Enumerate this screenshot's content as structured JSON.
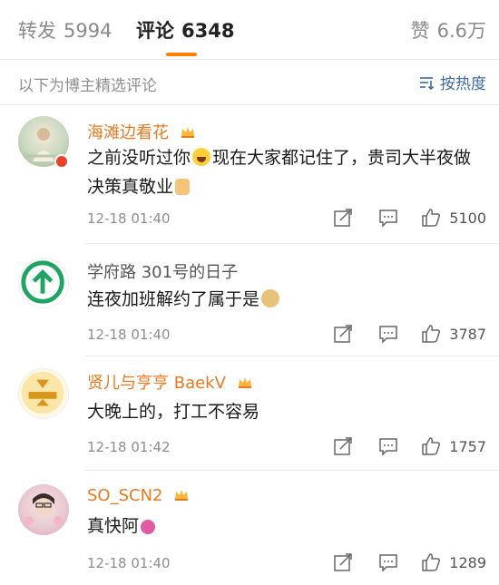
{
  "tabs": {
    "repost_label": "转发",
    "repost_count": "5994",
    "comment_label": "评论",
    "comment_count": "6348",
    "like_label": "赞",
    "like_count": "6.6万"
  },
  "subbar": {
    "label": "以下为博主精选评论",
    "sort_label": "按热度"
  },
  "comments": [
    {
      "name": "海滩边看花",
      "text_a": "之前没听过你",
      "text_b": "现在大家都记住了，贵司大半夜做决策真敬业",
      "time": "12-18 01:40",
      "likes": "5100"
    },
    {
      "name": "学府路 301号的日子",
      "text_a": "连夜加班解约了属于是",
      "time": "12-18 01:40",
      "likes": "3787"
    },
    {
      "name": "贤儿与亨亨 BaekV",
      "text_a": "大晚上的，打工不容易",
      "time": "12-18 01:42",
      "likes": "1757"
    },
    {
      "name": "SO_SCN2",
      "text_a": "真快阿",
      "time": "12-18 01:40",
      "likes": "1289"
    }
  ],
  "colors": {
    "accent": "#ff8200",
    "username": "#e8791f",
    "link": "#3d6aa3"
  },
  "icons": [
    "vip-crown-icon",
    "share-icon",
    "reply-icon",
    "thumb-up-icon",
    "sort-icon"
  ]
}
